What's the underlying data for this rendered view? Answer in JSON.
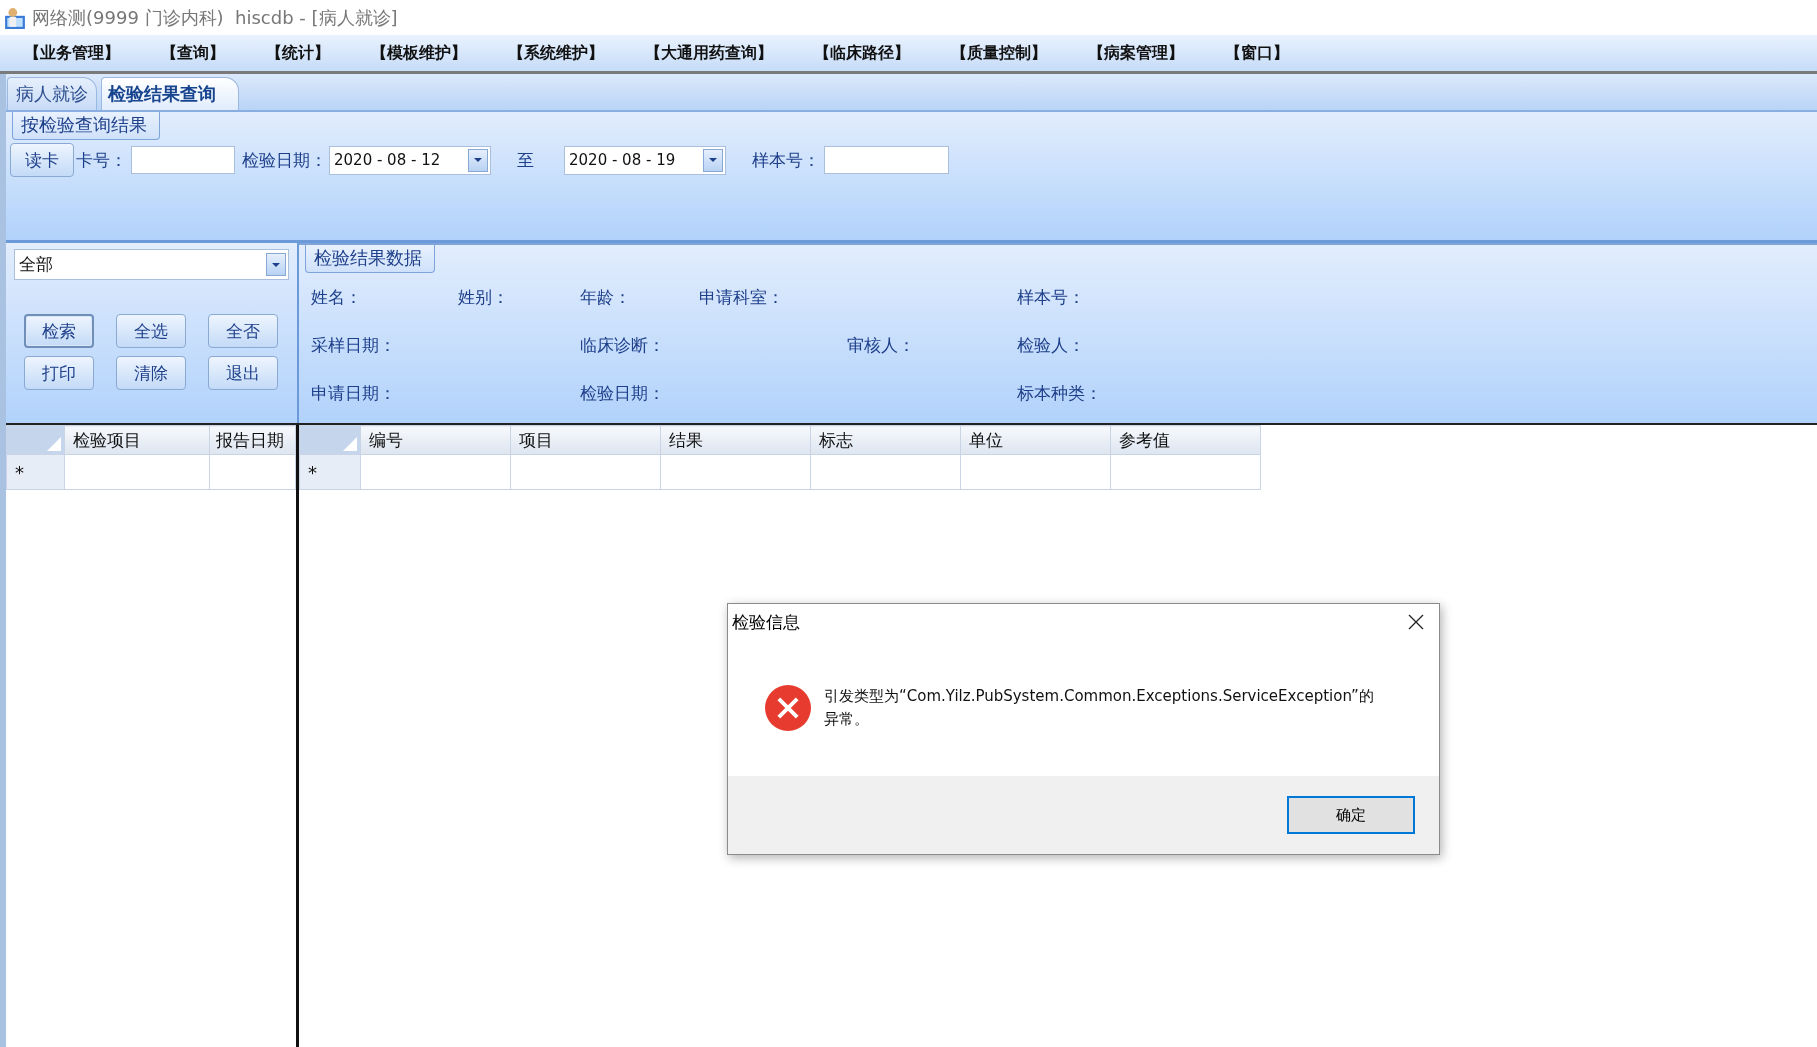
{
  "window": {
    "title": "网络测(9999 门诊内科)  hiscdb - [病人就诊]"
  },
  "menu": [
    "【业务管理】",
    "【查询】",
    "【统计】",
    "【模板维护】",
    "【系统维护】",
    "【大通用药查询】",
    "【临床路径】",
    "【质量控制】",
    "【病案管理】",
    "【窗口】"
  ],
  "tabs": [
    {
      "label": "病人就诊",
      "selected": false
    },
    {
      "label": "检验结果查询",
      "selected": true
    }
  ],
  "query": {
    "title": "按检验查询结果",
    "read_card_button": "读卡",
    "card_label": "卡号：",
    "date_label": "检验日期：",
    "date_from": "2020 - 08 - 12",
    "to_label": "至",
    "date_to": "2020 - 08 - 19",
    "sample_label": "样本号："
  },
  "filter": {
    "value": "全部"
  },
  "buttons": [
    {
      "label": "检索",
      "focused": true
    },
    {
      "label": "全选",
      "focused": false
    },
    {
      "label": "全否",
      "focused": false
    },
    {
      "label": "打印",
      "focused": false
    },
    {
      "label": "清除",
      "focused": false
    },
    {
      "label": "退出",
      "focused": false
    }
  ],
  "info": {
    "title": "检验结果数据",
    "rows": [
      [
        "姓名：",
        "姓别：",
        "年龄：",
        "申请科室：",
        "",
        "样本号："
      ],
      [
        "采样日期：",
        "",
        "临床诊断：",
        "",
        "审核人：",
        "检验人："
      ],
      [
        "申请日期：",
        "",
        "检验日期：",
        "",
        "",
        "标本种类："
      ]
    ]
  },
  "left_grid": {
    "columns": [
      "检验项目",
      "报告日期"
    ],
    "new_row_marker": "*"
  },
  "right_grid": {
    "columns": [
      "编号",
      "项目",
      "结果",
      "标志",
      "单位",
      "参考值"
    ],
    "new_row_marker": "*"
  },
  "dialog": {
    "title": "检验信息",
    "message": "引发类型为“Com.Yilz.PubSystem.Common.Exceptions.ServiceException”的异常。",
    "ok_button": "确定"
  }
}
